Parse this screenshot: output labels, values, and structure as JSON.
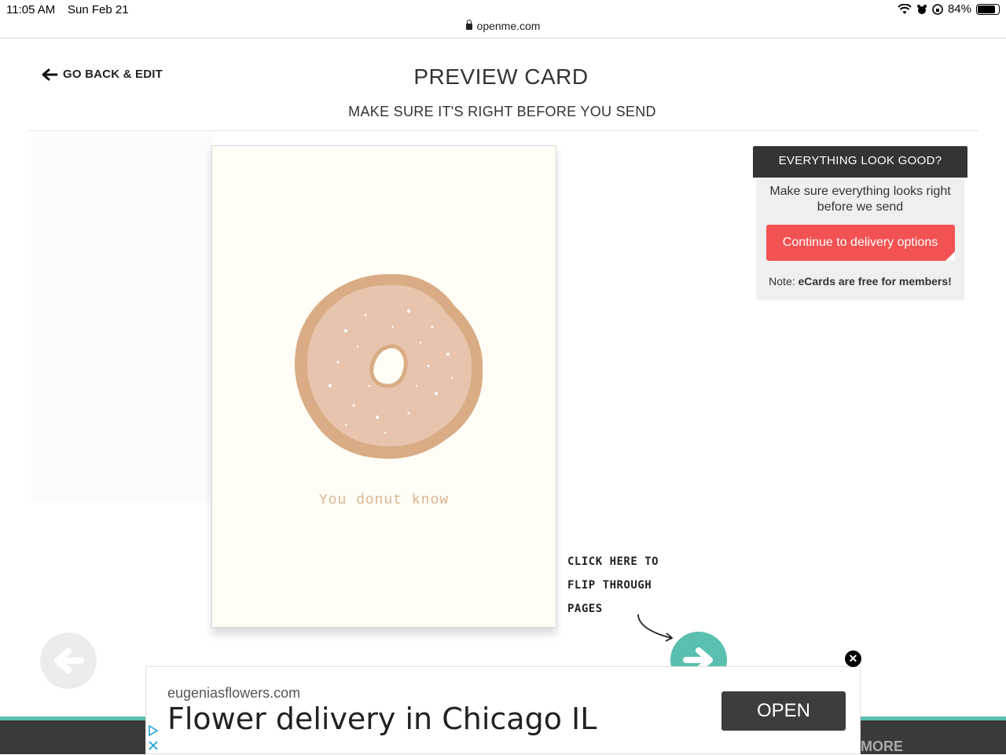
{
  "status_bar": {
    "time": "11:05 AM",
    "date": "Sun Feb 21",
    "battery": "84%",
    "battery_level": 0.84
  },
  "browser": {
    "url": "openme.com"
  },
  "header": {
    "back_label": "GO BACK & EDIT",
    "title": "PREVIEW CARD",
    "subtitle": "MAKE SURE IT'S RIGHT BEFORE YOU SEND"
  },
  "card": {
    "caption": "You donut know"
  },
  "hint": {
    "line1": "CLICK HERE TO",
    "line2": "FLIP THROUGH",
    "line3": "PAGES"
  },
  "side_panel": {
    "heading": "EVERYTHING LOOK GOOD?",
    "text": "Make sure everything looks right before we send",
    "cta_label": "Continue to delivery options",
    "note_prefix": "Note:",
    "note_bold": "eCards are free for members!"
  },
  "footer": {
    "more_label": "MORE"
  },
  "ad": {
    "domain": "eugeniasflowers.com",
    "headline": "Flower delivery in Chicago IL",
    "open_label": "OPEN",
    "close_symbol": "✕"
  },
  "colors": {
    "accent_teal": "#5bbfae",
    "cta_red": "#f35252",
    "panel_dark": "#333436",
    "donut_glaze": "#e8c4ad",
    "donut_dough": "#d9ac85"
  }
}
